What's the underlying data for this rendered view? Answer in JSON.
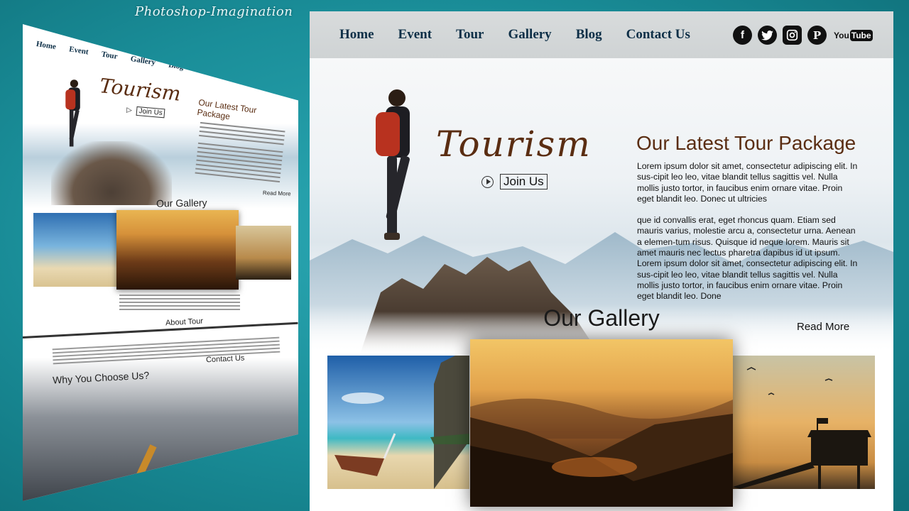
{
  "watermark": "Photoshop-Imagination",
  "thumbnail": {
    "nav": [
      "Home",
      "Event",
      "Tour",
      "Gallery",
      "Blog",
      "Contact Us"
    ],
    "title": "Tourism",
    "join_label": "Join Us",
    "package_title": "Our Latest Tour Package",
    "read_more": "Read More",
    "gallery_title": "Our Gallery",
    "about_title": "About Tour",
    "why_title": "Why You Choose Us?",
    "contact_title": "Contact Us"
  },
  "nav": {
    "links": [
      "Home",
      "Event",
      "Tour",
      "Gallery",
      "Blog",
      "Contact Us"
    ],
    "social": [
      "facebook-icon",
      "twitter-icon",
      "instagram-icon",
      "pinterest-icon",
      "youtube-icon"
    ],
    "youtube_label": "You",
    "youtube_tube": "Tube"
  },
  "hero": {
    "title": "Tourism",
    "join_label": "Join Us"
  },
  "package": {
    "title": "Our Latest Tour Package",
    "para1": "Lorem ipsum dolor sit amet, consectetur adipiscing elit. In sus-cipit leo leo, vitae blandit tellus sagittis vel. Nulla mollis justo tortor, in faucibus enim ornare vitae. Proin eget blandit leo. Donec ut ultricies",
    "para2": "que id convallis erat, eget rhoncus quam. Etiam sed mauris varius, molestie arcu a, consectetur urna. Aenean a elemen-tum risus. Quisque id neque lorem. Mauris sit amet mauris nec lectus pharetra dapibus id ut ipsum.",
    "para3": "Lorem ipsum dolor sit amet, consectetur adipiscing elit. In sus-cipit leo leo, vitae blandit tellus sagittis vel. Nulla mollis justo tortor, in faucibus enim ornare vitae. Proin eget blandit leo. Done",
    "read_more": "Read More"
  },
  "gallery": {
    "title": "Our Gallery"
  },
  "colors": {
    "nav_text": "#0d2f47",
    "title_brown": "#5a2d12",
    "background_teal": "#1a8e99"
  }
}
